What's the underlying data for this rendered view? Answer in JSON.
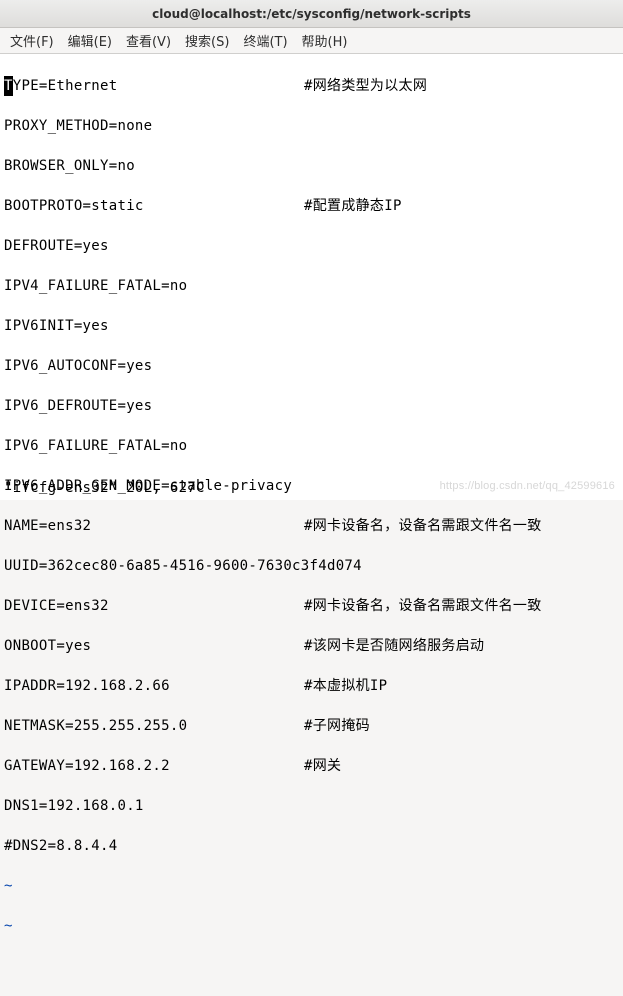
{
  "window": {
    "title": "cloud@localhost:/etc/sysconfig/network-scripts"
  },
  "menu": {
    "file": "文件(F)",
    "edit": "编辑(E)",
    "view": "查看(V)",
    "search": "搜索(S)",
    "terminal": "终端(T)",
    "help": "帮助(H)"
  },
  "content": {
    "cursor_char": "T",
    "line1_rest": "YPE=Ethernet",
    "line1_comment": "#网络类型为以太网",
    "line2": "PROXY_METHOD=none",
    "line3": "BROWSER_ONLY=no",
    "line4": "BOOTPROTO=static",
    "line4_comment": "#配置成静态IP",
    "line5": "DEFROUTE=yes",
    "line6": "IPV4_FAILURE_FATAL=no",
    "line7": "IPV6INIT=yes",
    "line8": "IPV6_AUTOCONF=yes",
    "line9": "IPV6_DEFROUTE=yes",
    "line10": "IPV6_FAILURE_FATAL=no",
    "line11": "IPV6_ADDR_GEN_MODE=stable-privacy",
    "line12": "NAME=ens32",
    "line12_comment": "#网卡设备名，设备名需跟文件名一致",
    "line13": "UUID=362cec80-6a85-4516-9600-7630c3f4d074",
    "line14": "DEVICE=ens32",
    "line14_comment": "#网卡设备名，设备名需跟文件名一致",
    "line15": "ONBOOT=yes",
    "line15_comment": "#该网卡是否随网络服务启动",
    "line16": "IPADDR=192.168.2.66",
    "line16_comment": "#本虚拟机IP",
    "line17": "NETMASK=255.255.255.0",
    "line17_comment": "#子网掩码",
    "line18": "GATEWAY=192.168.2.2",
    "line18_comment": "#网关",
    "line19": "DNS1=192.168.0.1",
    "line20": "#DNS2=8.8.4.4",
    "tilde": "~"
  },
  "status": {
    "text": "\"ifcfg-ens32\" 20L, 627C"
  },
  "watermark": "https://blog.csdn.net/qq_42599616"
}
